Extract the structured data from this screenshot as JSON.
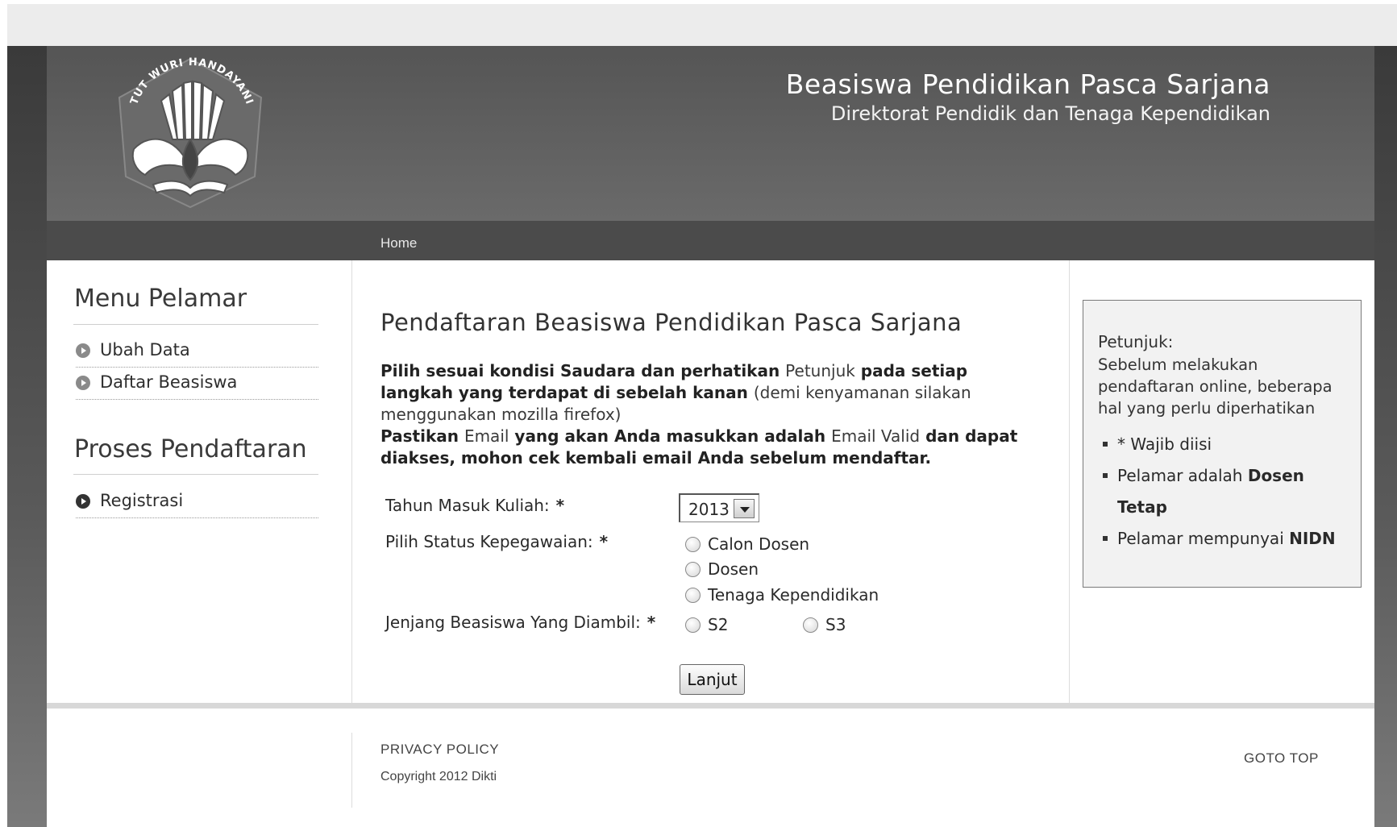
{
  "header": {
    "title": "Beasiswa Pendidikan Pasca Sarjana",
    "subtitle": "Direktorat Pendidik dan Tenaga Kependidikan",
    "logo_text": "TUT WURI HANDAYANI"
  },
  "nav": {
    "home": "Home"
  },
  "sidebar": {
    "menu_heading": "Menu Pelamar",
    "menu_items": [
      {
        "label": "Ubah Data"
      },
      {
        "label": "Daftar Beasiswa"
      }
    ],
    "proses_heading": "Proses Pendaftaran",
    "proses_items": [
      {
        "label": "Registrasi"
      }
    ]
  },
  "main": {
    "title": "Pendaftaran Beasiswa Pendidikan Pasca Sarjana",
    "intro": {
      "p1_a": "Pilih sesuai kondisi Saudara dan perhatikan ",
      "p1_b": "Petunjuk",
      "p1_c": " pada setiap langkah yang terdapat di sebelah kanan ",
      "p1_d": "(demi kenyamanan silakan menggunakan mozilla firefox)",
      "p2_a": "Pastikan ",
      "p2_b": "Email",
      "p2_c": " yang akan Anda masukkan adalah ",
      "p2_d": "Email Valid",
      "p2_e": " dan dapat diakses, mohon cek kembali email Anda sebelum mendaftar."
    },
    "form": {
      "tahun_label": "Tahun Masuk Kuliah:",
      "tahun_value": "2013",
      "status_label": "Pilih Status Kepegawaian:",
      "status_options": [
        "Calon Dosen",
        "Dosen",
        "Tenaga Kependidikan"
      ],
      "jenjang_label": "Jenjang Beasiswa Yang Diambil:",
      "jenjang_options": [
        "S2",
        "S3"
      ],
      "required_mark": "*",
      "submit_label": "Lanjut"
    }
  },
  "tips": {
    "heading": "Petunjuk:",
    "text": "Sebelum melakukan pendaftaran online, beberapa hal yang perlu diperhatikan",
    "item1": "* Wajib diisi",
    "item2_a": "Pelamar adalah ",
    "item2_b": "Dosen Tetap",
    "item3_a": "Pelamar mempunyai ",
    "item3_b": "NIDN"
  },
  "footer": {
    "privacy": "PRIVACY POLICY",
    "copyright": "Copyright 2012 Dikti",
    "goto_top": "GOTO TOP"
  }
}
